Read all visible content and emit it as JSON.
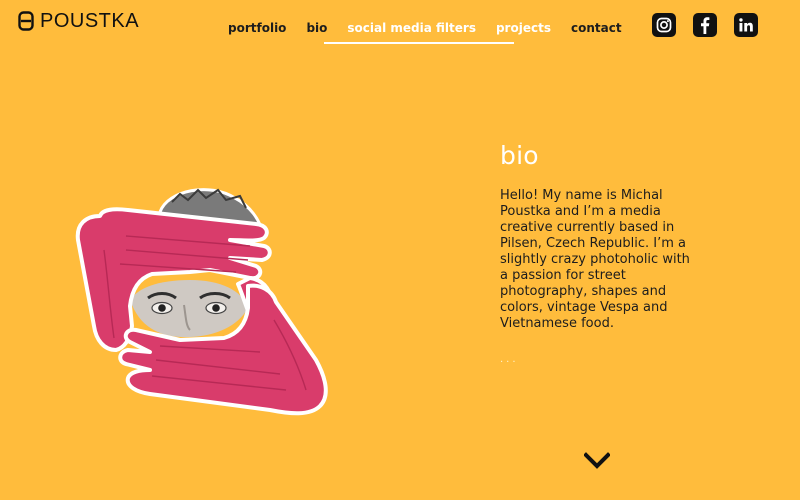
{
  "brand": {
    "name": "POUSTKA"
  },
  "nav": {
    "items": [
      {
        "label": "portfolio"
      },
      {
        "label": "bio"
      },
      {
        "label": "social media filters"
      },
      {
        "label": "projects"
      },
      {
        "label": "contact"
      }
    ],
    "active": "social media filters"
  },
  "socials": [
    {
      "icon": "instagram-icon"
    },
    {
      "icon": "facebook-icon"
    },
    {
      "icon": "linkedin-icon"
    }
  ],
  "bio": {
    "title": "bio",
    "text": "Hello! My name is Michal Poustka and I’m a media creative currently based in Pilsen, Czech Republic. I’m a slightly crazy photoholic with a passion for street photography, shapes and colors, vintage Vespa and Vietnamese food.",
    "more": "..."
  },
  "scroll": {
    "icon": "chevron-down-icon"
  },
  "colors": {
    "background": "#ffbc3c",
    "hands": "#d93c6b",
    "text_dark": "#1d1d1d",
    "text_light": "#ffffff"
  }
}
